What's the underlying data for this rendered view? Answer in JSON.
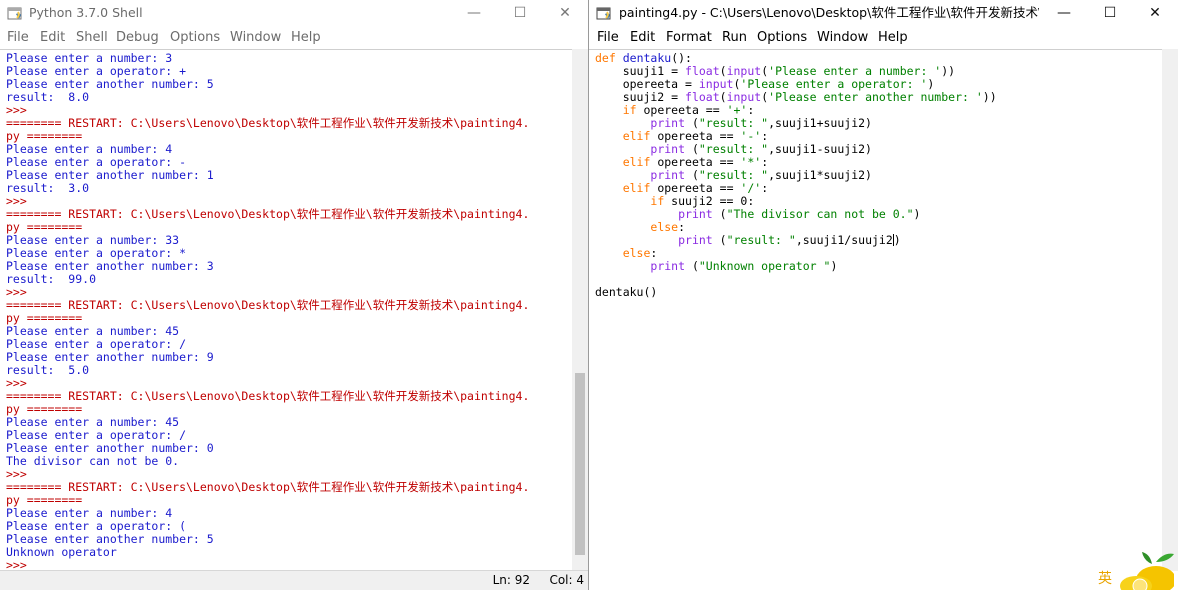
{
  "shell": {
    "title": "Python 3.7.0 Shell",
    "controls": {
      "minimize": "—",
      "maximize": "☐",
      "close": "✕"
    },
    "menu": [
      "File",
      "Edit",
      "Shell",
      "Debug",
      "Options",
      "Window",
      "Help"
    ],
    "lines": [
      "Please enter a number: 3",
      "Please enter a operator: +",
      "Please enter another number: 5",
      "result:  8.0",
      ">>> ",
      "======== RESTART: C:\\Users\\Lenovo\\Desktop\\软件工程作业\\软件开发新技术\\painting4.",
      "py ========",
      "Please enter a number: 4",
      "Please enter a operator: -",
      "Please enter another number: 1",
      "result:  3.0",
      ">>> ",
      "======== RESTART: C:\\Users\\Lenovo\\Desktop\\软件工程作业\\软件开发新技术\\painting4.",
      "py ========",
      "Please enter a number: 33",
      "Please enter a operator: *",
      "Please enter another number: 3",
      "result:  99.0",
      ">>> ",
      "======== RESTART: C:\\Users\\Lenovo\\Desktop\\软件工程作业\\软件开发新技术\\painting4.",
      "py ========",
      "Please enter a number: 45",
      "Please enter a operator: /",
      "Please enter another number: 9",
      "result:  5.0",
      ">>> ",
      "======== RESTART: C:\\Users\\Lenovo\\Desktop\\软件工程作业\\软件开发新技术\\painting4.",
      "py ========",
      "Please enter a number: 45",
      "Please enter a operator: /",
      "Please enter another number: 0",
      "The divisor can not be 0.",
      ">>> ",
      "======== RESTART: C:\\Users\\Lenovo\\Desktop\\软件工程作业\\软件开发新技术\\painting4.",
      "py ========",
      "Please enter a number: 4",
      "Please enter a operator: (",
      "Please enter another number: 5",
      "Unknown operator",
      ">>> "
    ],
    "status": {
      "ln": "Ln: 92",
      "col": "Col: 4"
    }
  },
  "editor": {
    "title": "painting4.py - C:\\Users\\Lenovo\\Desktop\\软件工程作业\\软件开发新技术\\...",
    "controls": {
      "minimize": "—",
      "maximize": "☐",
      "close": "✕"
    },
    "menu": [
      "File",
      "Edit",
      "Format",
      "Run",
      "Options",
      "Window",
      "Help"
    ],
    "code": [
      "def dentaku():",
      "    suuji1 = float(input('Please enter a number: '))",
      "    opereeta = input('Please enter a operator: ')",
      "    suuji2 = float(input('Please enter another number: '))",
      "    if opereeta == '+':",
      "        print (\"result: \",suuji1+suuji2)",
      "    elif opereeta == '-':",
      "        print (\"result: \",suuji1-suuji2)",
      "    elif opereeta == '*':",
      "        print (\"result: \",suuji1*suuji2)",
      "    elif opereeta == '/':",
      "        if suuji2 == 0:",
      "            print (\"The divisor can not be 0.\")",
      "        else:",
      "            print (\"result: \",suuji1/suuji2)",
      "    else:",
      "        print (\"Unknown operator \")",
      "",
      "dentaku()"
    ],
    "ime_indicator": "英"
  },
  "colors": {
    "keyword": "#ff7700",
    "string": "#008000",
    "builtin": "#8a2be2",
    "defname": "#1a1acd",
    "stdout": "#1a1acd",
    "console": "#bf0000"
  }
}
